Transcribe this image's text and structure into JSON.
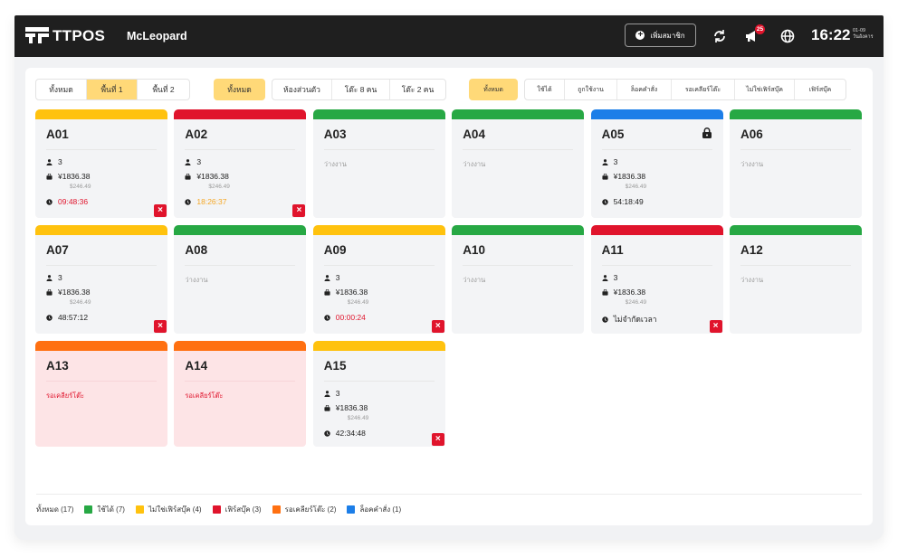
{
  "app": {
    "logo_text": "TTPOS",
    "store_name": "McLeopard"
  },
  "topbar": {
    "add_member_label": "เพิ่มสมาชิก",
    "notification_count": "25",
    "time": "16:22",
    "date_line1": "01-09",
    "date_line2": "วันอังคาร"
  },
  "filters": {
    "zone": [
      {
        "label": "ทั้งหมด",
        "active": false
      },
      {
        "label": "พื้นที่ 1",
        "active": true
      },
      {
        "label": "พื้นที่ 2",
        "active": false
      }
    ],
    "type_all": "ทั้งหมด",
    "type": [
      {
        "label": "ห้องส่วนตัว"
      },
      {
        "label": "โต๊ะ 8 คน"
      },
      {
        "label": "โต๊ะ 2 คน"
      }
    ],
    "status_all": "ทั้งหมด",
    "status": [
      {
        "label": "ใช้ได้"
      },
      {
        "label": "ถูกใช้งาน"
      },
      {
        "label": "ล็อคคำสั่ง"
      },
      {
        "label": "รอเคลียร์โต๊ะ"
      },
      {
        "label": "ไม่ใช่เฟิร์สบุ๊ค"
      },
      {
        "label": "เฟิร์สบุ๊ค"
      }
    ]
  },
  "colors": {
    "yellow": "#ffc20e",
    "red": "#e0142c",
    "green": "#27a844",
    "blue": "#1c7ee8",
    "orange": "#ff7011"
  },
  "tables": [
    {
      "name": "A01",
      "color": "yellow",
      "guests": "3",
      "amount": "¥1836.38",
      "sub": "$246.49",
      "time": "09:48:36",
      "time_color": "red",
      "close": true
    },
    {
      "name": "A02",
      "color": "red",
      "guests": "3",
      "amount": "¥1836.38",
      "sub": "$246.49",
      "time": "18:26:37",
      "time_color": "orange",
      "close": true
    },
    {
      "name": "A03",
      "color": "green",
      "status": "ว่างงาน"
    },
    {
      "name": "A04",
      "color": "green",
      "status": "ว่างงาน"
    },
    {
      "name": "A05",
      "color": "blue",
      "guests": "3",
      "amount": "¥1836.38",
      "sub": "$246.49",
      "time": "54:18:49",
      "time_color": "dark",
      "locked": true
    },
    {
      "name": "A06",
      "color": "green",
      "status": "ว่างงาน"
    },
    {
      "name": "A07",
      "color": "yellow",
      "guests": "3",
      "amount": "¥1836.38",
      "sub": "$246.49",
      "time": "48:57:12",
      "time_color": "dark",
      "close": true
    },
    {
      "name": "A08",
      "color": "green",
      "status": "ว่างงาน"
    },
    {
      "name": "A09",
      "color": "yellow",
      "guests": "3",
      "amount": "¥1836.38",
      "sub": "$246.49",
      "time": "00:00:24",
      "time_color": "red",
      "close": true
    },
    {
      "name": "A10",
      "color": "green",
      "status": "ว่างงาน"
    },
    {
      "name": "A11",
      "color": "red",
      "guests": "3",
      "amount": "¥1836.38",
      "sub": "$246.49",
      "time": "ไม่จำกัดเวลา",
      "time_color": "dark",
      "close": true
    },
    {
      "name": "A12",
      "color": "green",
      "status": "ว่างงาน"
    },
    {
      "name": "A13",
      "color": "orange",
      "status": "รอเคลียร์โต๊ะ",
      "pink": true
    },
    {
      "name": "A14",
      "color": "orange",
      "status": "รอเคลียร์โต๊ะ",
      "pink": true
    },
    {
      "name": "A15",
      "color": "yellow",
      "guests": "3",
      "amount": "¥1836.38",
      "sub": "$246.49",
      "time": "42:34:48",
      "time_color": "dark",
      "close": true
    }
  ],
  "legend": {
    "total": "ทั้งหมด (17)",
    "items": [
      {
        "label": "ใช้ได้ (7)",
        "color": "green"
      },
      {
        "label": "ไม่ใช่เฟิร์สบุ๊ค (4)",
        "color": "yellow"
      },
      {
        "label": "เฟิร์สบุ๊ค (3)",
        "color": "red"
      },
      {
        "label": "รอเคลียร์โต๊ะ (2)",
        "color": "orange"
      },
      {
        "label": "ล็อคคำสั่ง (1)",
        "color": "blue"
      }
    ]
  }
}
